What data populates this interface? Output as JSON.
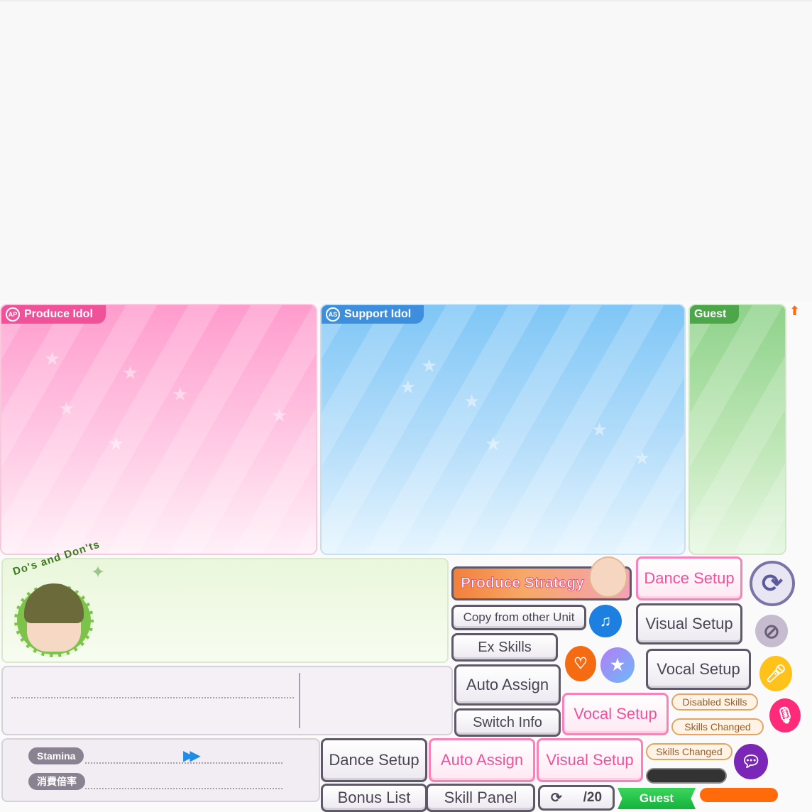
{
  "panels": {
    "produce_label": "Produce Idol",
    "produce_badge": "AP",
    "support_label": "Support Idol",
    "support_badge": "AS",
    "guest_label": "Guest"
  },
  "dos": {
    "title": "Do's and Don'ts"
  },
  "stamina": {
    "stamina_label": "Stamina",
    "ratio_label": "消費倍率"
  },
  "buttons": {
    "produce_strategy": "Produce Strategy",
    "dance_setup_top": "Dance Setup",
    "copy_other": "Copy from other Unit",
    "visual_setup_right": "Visual Setup",
    "ex_skills": "Ex Skills",
    "vocal_setup_right": "Vocal Setup",
    "auto_assign_mid": "Auto Assign",
    "vocal_setup_pink": "Vocal Setup",
    "switch_info": "Switch Info",
    "dance_setup_bottom": "Dance Setup",
    "auto_assign_pink": "Auto Assign",
    "visual_setup_pink": "Visual Setup",
    "bonus_list": "Bonus List",
    "skill_panel": "Skill Panel"
  },
  "chips": {
    "disabled_skills": "Disabled Skills",
    "skills_changed_1": "Skills Changed",
    "skills_changed_2": "Skills Changed"
  },
  "counter": {
    "text": "/20"
  },
  "guest_tag": "Guest",
  "colors": {
    "produce_pink": "#f0529a",
    "support_blue": "#3d8fdd",
    "guest_green": "#4ea64a",
    "accent_orange": "#ff6a0a"
  }
}
